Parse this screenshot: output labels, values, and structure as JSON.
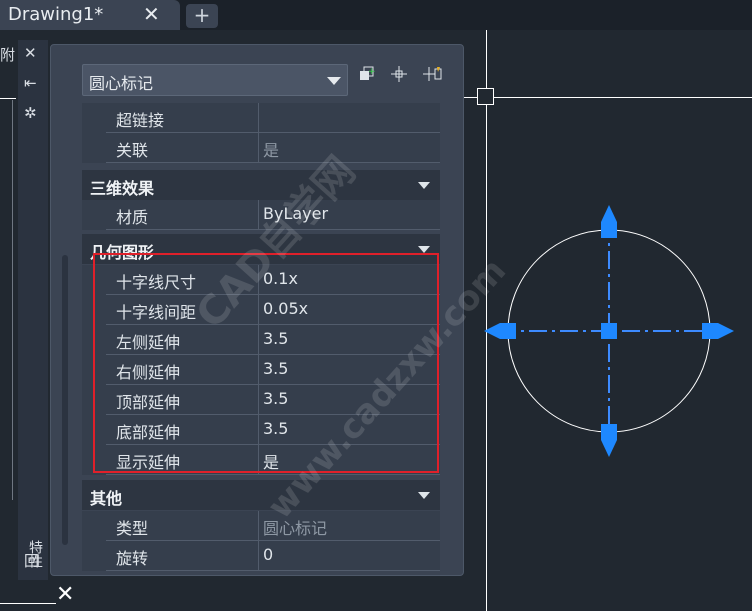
{
  "tab": {
    "title": "Drawing1*",
    "close": "✕",
    "add": "+"
  },
  "edge": {
    "char": "附"
  },
  "strip": {
    "close": "✕",
    "pin": "⇤",
    "gear": "✲",
    "vertical_label": "特性",
    "bottom_icon": "回"
  },
  "panel": {
    "selector": "圆心标记",
    "toolbar": [
      "quick-select-icon",
      "select-objects-icon",
      "toggle-pickadd-icon"
    ],
    "sections": [
      {
        "rows": [
          {
            "label": "超链接",
            "value": ""
          },
          {
            "label": "关联",
            "value": "是"
          }
        ]
      },
      {
        "title": "三维效果",
        "rows": [
          {
            "label": "材质",
            "value": "ByLayer"
          }
        ]
      },
      {
        "title": "几何图形",
        "rows": [
          {
            "label": "十字线尺寸",
            "value": "0.1x"
          },
          {
            "label": "十字线间距",
            "value": "0.05x"
          },
          {
            "label": "左侧延伸",
            "value": "3.5"
          },
          {
            "label": "右侧延伸",
            "value": "3.5"
          },
          {
            "label": "顶部延伸",
            "value": "3.5"
          },
          {
            "label": "底部延伸",
            "value": "3.5"
          },
          {
            "label": "显示延伸",
            "value": "是"
          }
        ]
      },
      {
        "title": "其他",
        "rows": [
          {
            "label": "类型",
            "value": "圆心标记"
          },
          {
            "label": "旋转",
            "value": "0"
          }
        ]
      }
    ]
  },
  "watermark": {
    "text1": "CAD自学网",
    "text2": "www.cadzxw.com"
  },
  "colors": {
    "grip": "#1e88ff",
    "highlight": "#e0202a",
    "background": "#212830"
  }
}
